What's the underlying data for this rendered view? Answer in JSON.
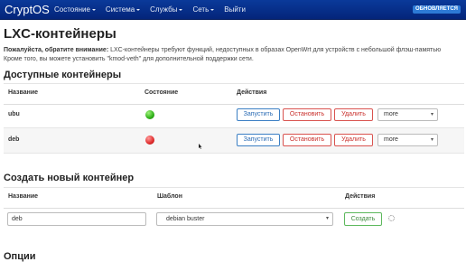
{
  "navbar": {
    "brand": "CryptOS",
    "menu": [
      {
        "label": "Состояние",
        "has_dropdown": true
      },
      {
        "label": "Система",
        "has_dropdown": true
      },
      {
        "label": "Службы",
        "has_dropdown": true
      },
      {
        "label": "Сеть",
        "has_dropdown": true
      },
      {
        "label": "Выйти",
        "has_dropdown": false
      }
    ],
    "badge": "ОБНОВЛЯЕТСЯ"
  },
  "page": {
    "title": "LXC-контейнеры",
    "notice_bold": "Пожалуйста, обратите внимание:",
    "notice_text": " LXC-контейнеры требуют функций, недоступных в образах OpenWrt для устройств с небольшой флэш-памятью",
    "notice_line2": "Кроме того, вы можете установить \"kmod-veth\" для дополнительной поддержки сети."
  },
  "available": {
    "title": "Доступные контейнеры",
    "headers": {
      "name": "Название",
      "state": "Состояние",
      "actions": "Действия"
    },
    "rows": [
      {
        "name": "ubu",
        "state": "running",
        "state_color": "#2fb018",
        "start": "Запустить",
        "stop": "Остановить",
        "delete": "Удалить",
        "more": "more"
      },
      {
        "name": "deb",
        "state": "stopped",
        "state_color": "#e02b2b",
        "start": "Запустить",
        "stop": "Остановить",
        "delete": "Удалить",
        "more": "more"
      }
    ]
  },
  "create": {
    "title": "Создать новый контейнер",
    "headers": {
      "name": "Название",
      "template": "Шаблон",
      "actions": "Действия"
    },
    "name_value": "deb",
    "template_value": "debian buster",
    "create_label": "Создать"
  },
  "options": {
    "title": "Опции"
  },
  "colors": {
    "navbar": "#04257a",
    "primary": "#3b7fc4",
    "danger": "#d9534f",
    "success": "#5cb85c"
  }
}
